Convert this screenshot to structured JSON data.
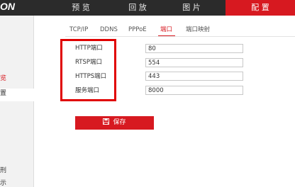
{
  "brand": {
    "logo_text": "ON"
  },
  "top_nav": {
    "items": [
      {
        "label": "预 览"
      },
      {
        "label": "回 放"
      },
      {
        "label": "图 片"
      },
      {
        "label": "配 置",
        "active": true
      }
    ]
  },
  "sidebar": {
    "items": [
      {
        "label": "览",
        "active": true
      },
      {
        "label": "置"
      },
      {
        "label": "刑"
      },
      {
        "label": "示"
      }
    ]
  },
  "tabs": [
    {
      "label": "TCP/IP"
    },
    {
      "label": "DDNS"
    },
    {
      "label": "PPPoE"
    },
    {
      "label": "端口",
      "active": true
    },
    {
      "label": "端口映射"
    }
  ],
  "form": {
    "fields": [
      {
        "label": "HTTP端口",
        "value": "80"
      },
      {
        "label": "RTSP端口",
        "value": "554"
      },
      {
        "label": "HTTPS端口",
        "value": "443"
      },
      {
        "label": "服务端口",
        "value": "8000"
      }
    ],
    "save_label": "保存"
  },
  "colors": {
    "accent": "#d71920",
    "topbar": "#2b2b2b",
    "highlight": "#e00000"
  },
  "icons": {
    "save": "floppy-disk-icon"
  }
}
